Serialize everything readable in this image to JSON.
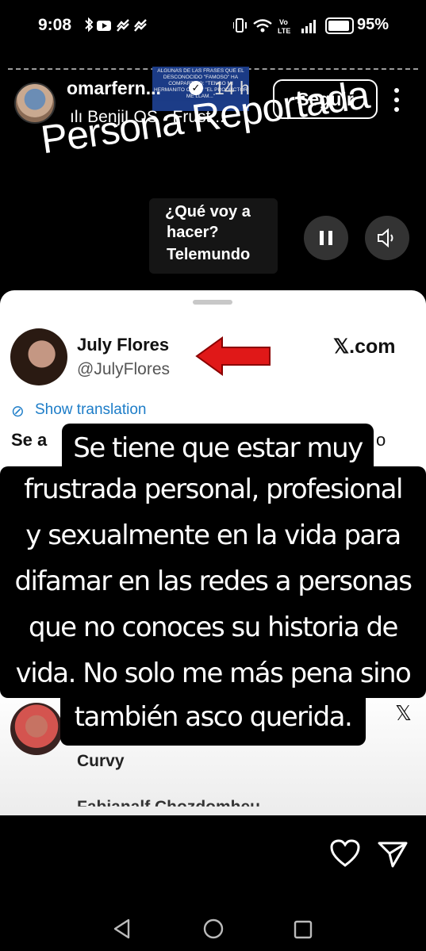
{
  "status_bar": {
    "time": "9:08",
    "left_icons": "✱▶ ✓✓",
    "right_icons": "▯ ◉ Vo LTE ▮▮▮",
    "battery_percent": "95%"
  },
  "story_header": {
    "username": "omarfern...",
    "time_ago": "14 h",
    "song": "ılı BenjiLOS · Frust...",
    "follow_label": "Seguir",
    "menu_icon": "more-vertical-icon"
  },
  "video_banner_text": "ALGUNAS DE LAS FRASES QUE EL DESCONOCIDO \"FAMOSO\" HA COMPARTIDO: \"TENGO MI HERMANITO OMAR\" \"EL PRODUCTOR ME LLAM...\"",
  "sticker_text": "Persona Reportada",
  "video_caption": {
    "line1": "¿Qué voy a",
    "line2": "hacer?",
    "line3": "Telemundo"
  },
  "tweet": {
    "name": "July Flores",
    "handle": "@JulyFlores",
    "source": "𝕏.com",
    "translate_label": "Show translation",
    "partial_text_start": "Se a",
    "partial_text_end": "o"
  },
  "second_tweet": {
    "name_partial": "Curvy",
    "line_partial": "Fabianalf Chozdomheu..."
  },
  "overlay_text": {
    "line1": "Se tiene que estar muy",
    "line2": "frustrada personal, profesional",
    "line3": "y sexualmente en la vida para",
    "line4": "difamar en las redes a personas",
    "line5": "que no conoces su historia de",
    "line6": "vida. No solo me más pena sino",
    "line7": "también asco querida."
  },
  "colors": {
    "background": "#000000",
    "link_blue": "#1d7dc8",
    "arrow_red": "#e01818"
  }
}
